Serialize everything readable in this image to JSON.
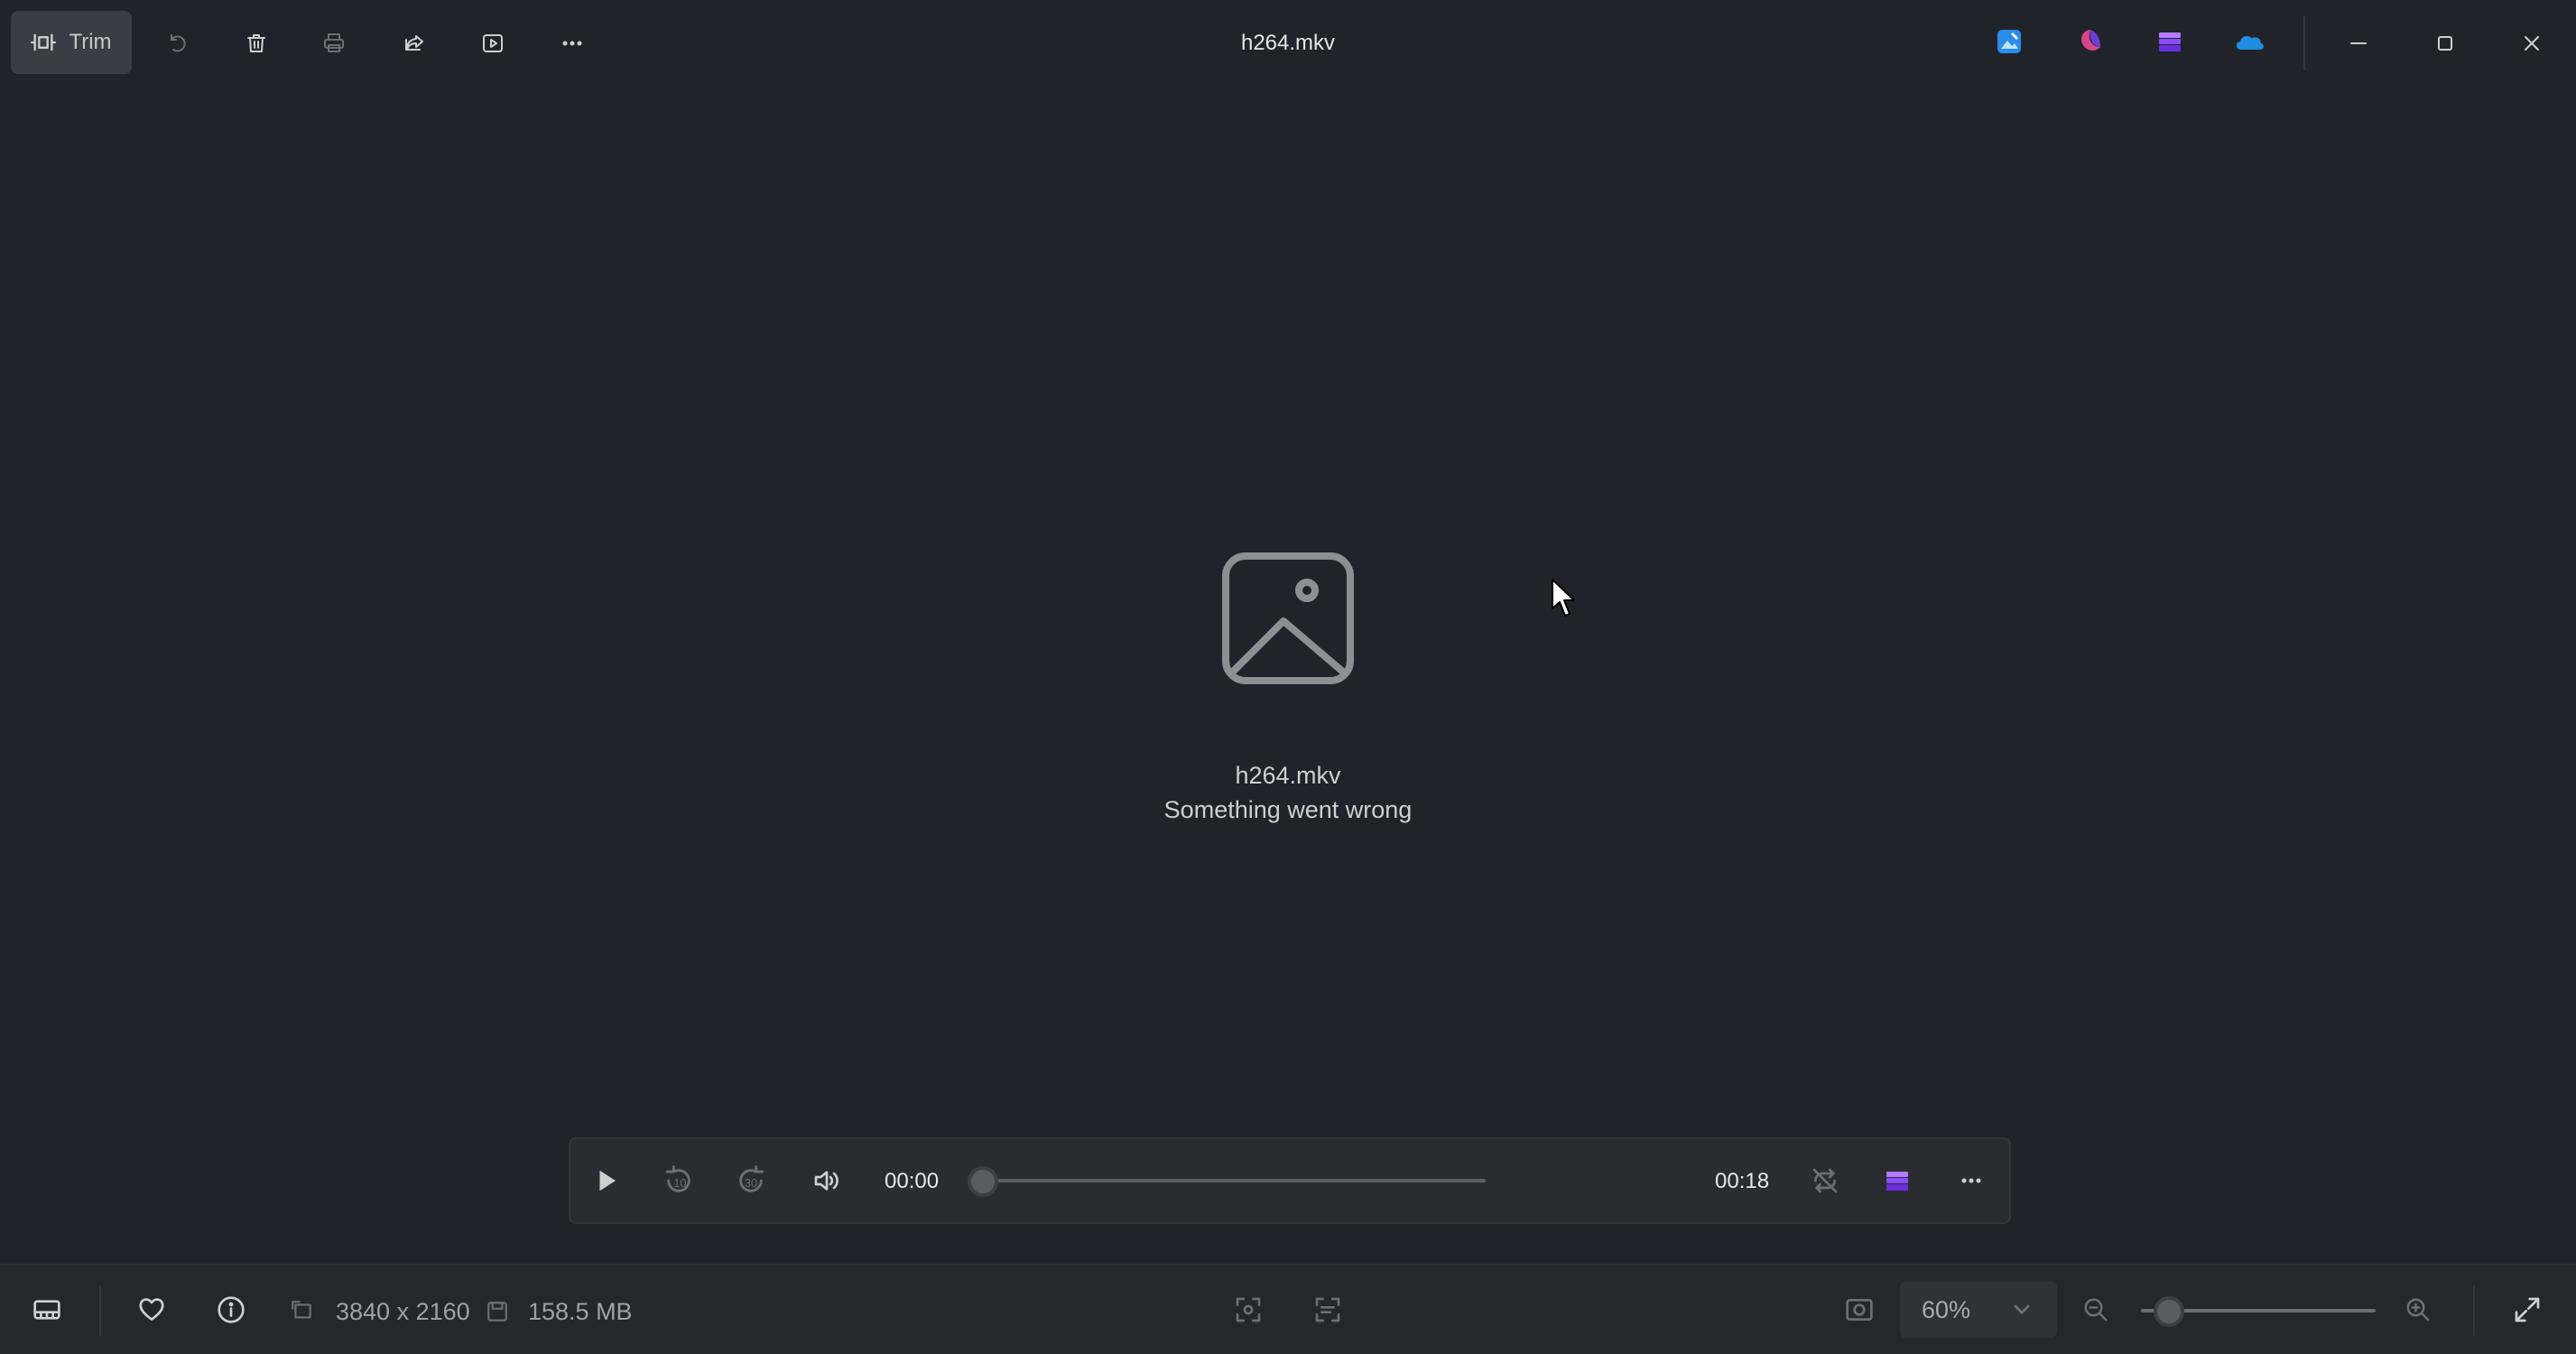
{
  "window": {
    "title": "h264.mkv"
  },
  "toolbar": {
    "trim_label": "Trim",
    "icons": [
      "trim-icon",
      "rotate-icon",
      "delete-icon",
      "print-icon",
      "share-icon",
      "slideshow-icon",
      "more-icon"
    ]
  },
  "apps": [
    "photos-editor-icon",
    "clipchamp-designer-icon",
    "clipchamp-icon",
    "onedrive-icon"
  ],
  "window_controls": [
    "minimize-icon",
    "maximize-icon",
    "close-icon"
  ],
  "viewer": {
    "file_name": "h264.mkv",
    "error_message": "Something went wrong"
  },
  "player": {
    "current_time": "00:00",
    "duration": "00:18",
    "progress": 0
  },
  "status": {
    "dimensions": "3840 x 2160",
    "file_size": "158.5 MB",
    "zoom": "60%",
    "zoom_slider_level": 0.1
  },
  "colors": {
    "background": "#20232a",
    "statusbar": "#25272c",
    "onedrive": "#1f8de0",
    "clipchamp": "#8a4dff"
  }
}
